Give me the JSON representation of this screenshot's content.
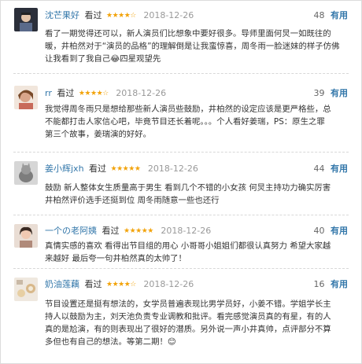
{
  "reviews": [
    {
      "user": "沈芒果好",
      "watched": "看过",
      "stars": "★★★★☆",
      "rating": 4,
      "date": "2018-12-26",
      "count": "48",
      "useful": "有用",
      "lines": [
        "看了一期觉得还可以，新人演员们比想象中要好很多。导师里面何炅一如既往的",
        "暖，井柏然对于“演员的品格”的理解倒是让我蛮惊喜，周冬雨一脸迷妹的样子仿佛",
        "让我看到了我自己😂四星观望先"
      ]
    },
    {
      "user": "rr",
      "watched": "看过",
      "stars": "★★★★☆",
      "rating": 4,
      "date": "2018-12-26",
      "count": "39",
      "useful": "有用",
      "lines": [
        "我觉得周冬雨只是想给那些新人演员些鼓励，井柏然的设定应该是更严格些，总",
        "不能都打击人家信心吧，毕竟节目还长着呢。。。个人看好姜瑞，PS：原生之罪",
        "第三个故事，姜瑞演的好好。"
      ]
    },
    {
      "user": "姜小辉jxh",
      "watched": "看过",
      "stars": "★★★★★",
      "rating": 5,
      "date": "2018-12-26",
      "count": "44",
      "useful": "有用",
      "lines": [
        "鼓励 新人整体女生质量高于男生 看到几个不错的小女孩 何炅主持功力确实厉害",
        "井柏然评价选手还挺到位 周冬雨随意一些也还行"
      ]
    },
    {
      "user": "一个の老阿姨",
      "watched": "看过",
      "stars": "★★★★★",
      "rating": 5,
      "date": "2018-12-26",
      "count": "40",
      "useful": "有用",
      "lines": [
        "真情实感的喜欢 看得出节目组的用心 小哥哥小姐姐们都很认真努力 希望大家越",
        "来越好 最后夸一句井柏然真的太帅了！"
      ]
    },
    {
      "user": "奶油莲藕",
      "watched": "看过",
      "stars": "★★★★☆",
      "rating": 4,
      "date": "2018-12-26",
      "count": "16",
      "useful": "有用",
      "lines": [
        "节目设置还是挺有想法的，女学员普遍表现比男学员好，小姜不错。学姐学长主",
        "持人以鼓励为主，刘天池负责专业调教和批评。看完感觉演员真的有星，有的人",
        "真的是尬演，有的则表现出了很好的潜质。另外说一声小井真帅，点评部分不算",
        "多但也有自己的想法。等第二期！😊"
      ]
    }
  ]
}
